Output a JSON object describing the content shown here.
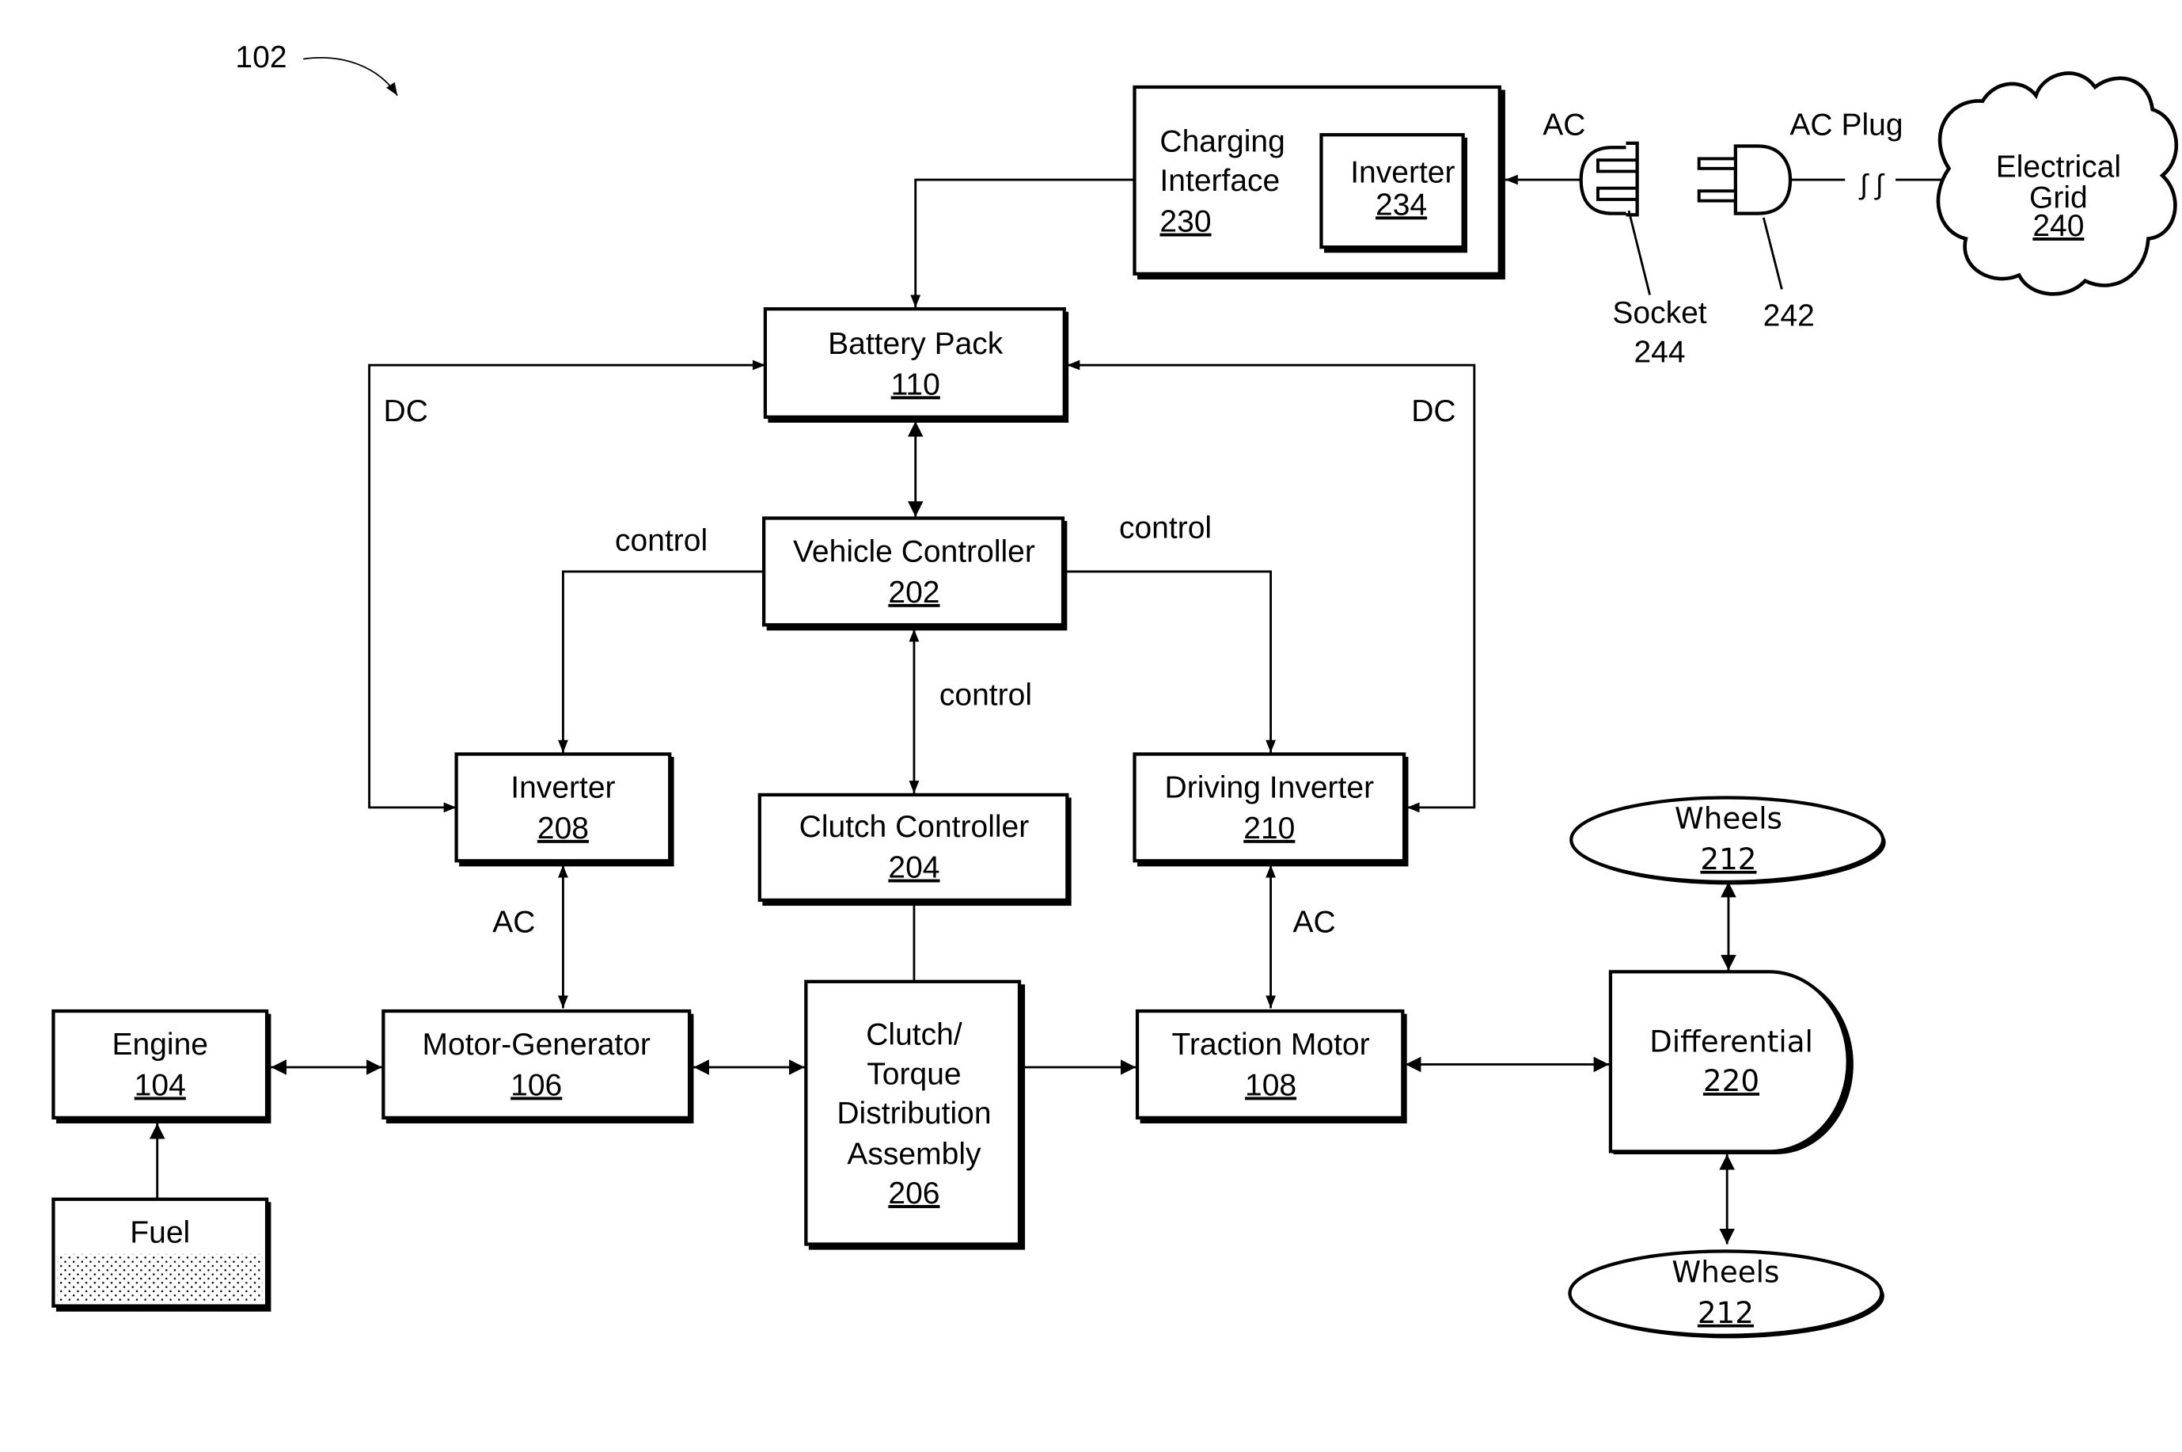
{
  "figure_ref": "102",
  "blocks": {
    "charging_interface": {
      "label_lines": [
        "Charging",
        "Interface"
      ],
      "number": "230"
    },
    "inverter_234": {
      "label": "Inverter",
      "number": "234"
    },
    "battery_pack": {
      "label": "Battery Pack",
      "number": "110"
    },
    "vehicle_controller": {
      "label": "Vehicle Controller",
      "number": "202"
    },
    "inverter_208": {
      "label": "Inverter",
      "number": "208"
    },
    "clutch_controller": {
      "label": "Clutch Controller",
      "number": "204"
    },
    "driving_inverter": {
      "label": "Driving Inverter",
      "number": "210"
    },
    "engine": {
      "label": "Engine",
      "number": "104"
    },
    "motor_generator": {
      "label": "Motor-Generator",
      "number": "106"
    },
    "clutch_torque": {
      "label_lines": [
        "Clutch/",
        "Torque",
        "Distribution",
        "Assembly"
      ],
      "number": "206"
    },
    "traction_motor": {
      "label": "Traction Motor",
      "number": "108"
    },
    "differential": {
      "label": "Differential",
      "number": "220"
    },
    "wheels_top": {
      "label": "Wheels",
      "number": "212"
    },
    "wheels_bottom": {
      "label": "Wheels",
      "number": "212"
    },
    "fuel": {
      "label": "Fuel"
    },
    "electrical_grid": {
      "label_lines": [
        "Electrical",
        "Grid"
      ],
      "number": "240"
    }
  },
  "connectors": {
    "socket_label": "Socket",
    "socket_number": "244",
    "plug_number": "242",
    "ac_plug_label": "AC Plug",
    "cord_break": "∫ ∫"
  },
  "edge_labels": {
    "ac_charging": "AC",
    "dc_left": "DC",
    "dc_right": "DC",
    "control_left": "control",
    "control_right": "control",
    "control_center": "control",
    "ac_left": "AC",
    "ac_right": "AC"
  }
}
